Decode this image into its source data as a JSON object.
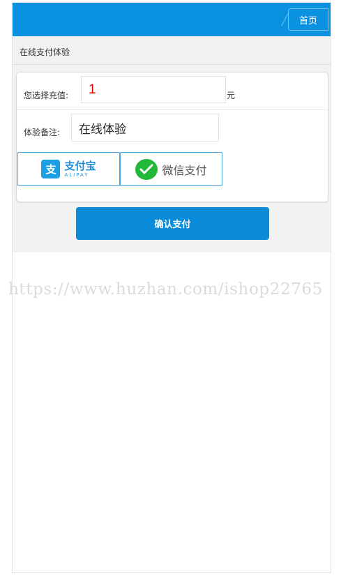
{
  "header": {
    "home_label": "首页",
    "color": "#0a91df"
  },
  "section": {
    "title": "在线支付体验"
  },
  "form": {
    "amount_label": "您选择充值:",
    "amount_value": "1",
    "amount_unit": "元",
    "note_label": "体验备注:",
    "note_value": "在线体验"
  },
  "payment_methods": [
    {
      "name": "alipay",
      "label_cn": "支付宝",
      "label_en": "ALIPAY",
      "icon": "alipay-icon",
      "color": "#1ca0e3"
    },
    {
      "name": "wechat",
      "label_cn": "微信支付",
      "icon": "wechat-icon",
      "color": "#22b83a"
    }
  ],
  "confirm": {
    "label": "确认支付",
    "color": "#0a8cda"
  },
  "watermark": {
    "text": "https://www.huzhan.com/ishop22765"
  }
}
